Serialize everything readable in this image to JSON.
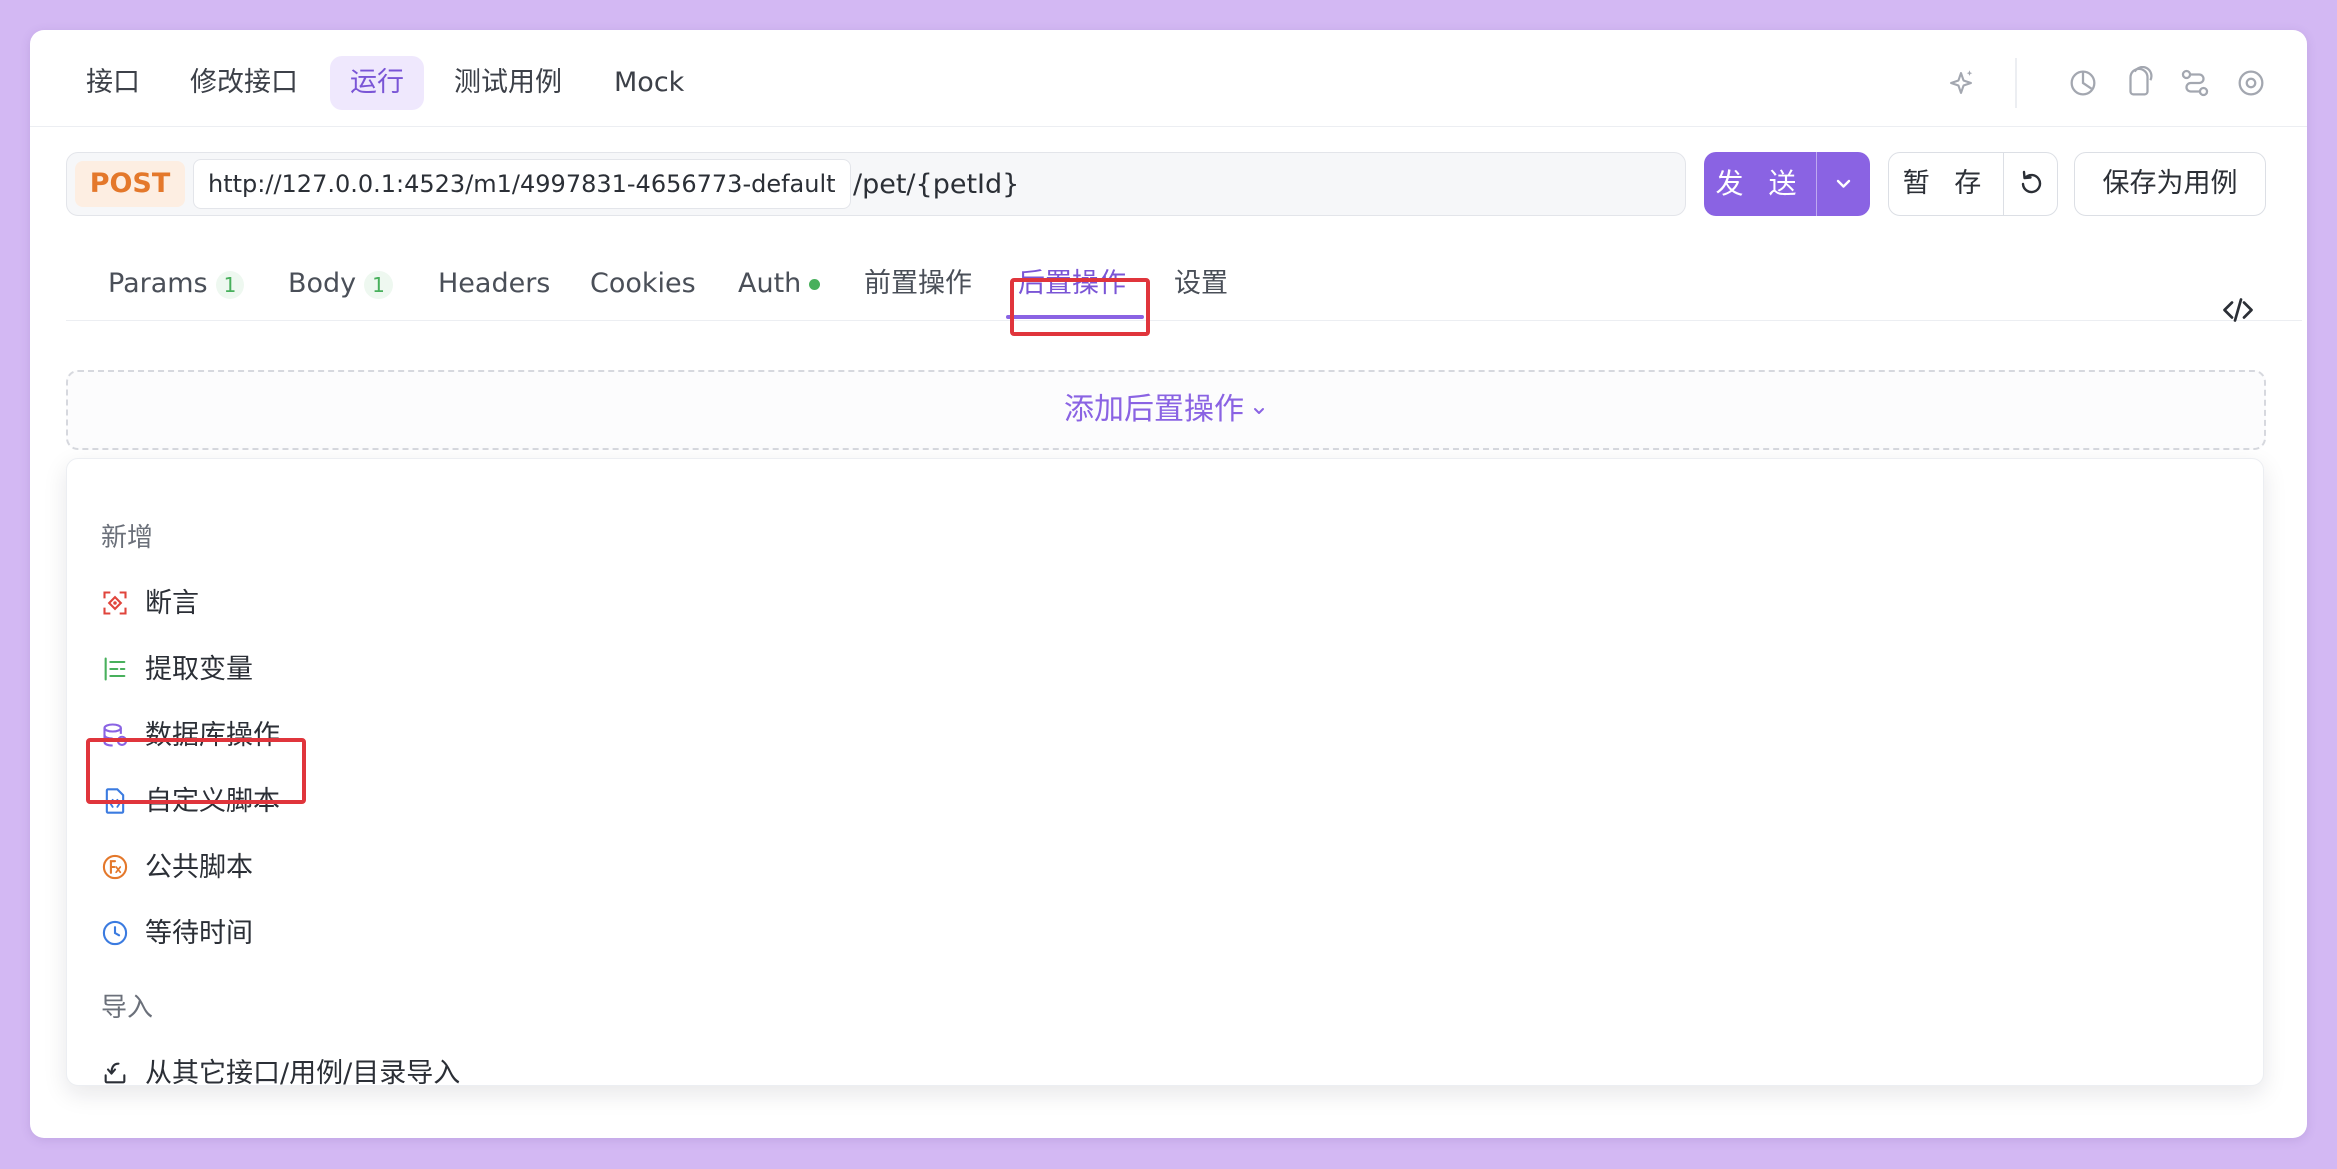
{
  "top_nav": {
    "tabs": [
      {
        "label": "接口"
      },
      {
        "label": "修改接口"
      },
      {
        "label": "运行",
        "active": true
      },
      {
        "label": "测试用例"
      },
      {
        "label": "Mock"
      }
    ],
    "icons": [
      "ai-sparkle-icon",
      "chart-icon",
      "bookmark-icon",
      "flow-icon",
      "settings-icon"
    ]
  },
  "request": {
    "method": "POST",
    "base_url": "http://127.0.0.1:4523/m1/4997831-4656773-default",
    "path": "/pet/{petId}",
    "send_label": "发 送",
    "stage_label": "暂 存",
    "save_case_label": "保存为用例"
  },
  "sub_tabs": {
    "items": [
      {
        "label": "Params",
        "badge": "1"
      },
      {
        "label": "Body",
        "badge": "1"
      },
      {
        "label": "Headers"
      },
      {
        "label": "Cookies"
      },
      {
        "label": "Auth",
        "dot": true
      },
      {
        "label": "前置操作"
      },
      {
        "label": "后置操作",
        "active": true
      },
      {
        "label": "设置"
      }
    ]
  },
  "post_ops": {
    "add_label": "添加后置操作"
  },
  "dropdown": {
    "group_new": "新增",
    "items_new": [
      {
        "label": "断言",
        "icon": "assert-icon",
        "color": "#e0453c"
      },
      {
        "label": "提取变量",
        "icon": "extract-variable-icon",
        "color": "#48b05c"
      },
      {
        "label": "数据库操作",
        "icon": "database-icon",
        "color": "#8a63e3"
      },
      {
        "label": "自定义脚本",
        "icon": "script-file-icon",
        "color": "#3b7be0"
      },
      {
        "label": "公共脚本",
        "icon": "function-icon",
        "color": "#e4782b"
      },
      {
        "label": "等待时间",
        "icon": "clock-icon",
        "color": "#3b7be0"
      }
    ],
    "group_import": "导入",
    "items_import": [
      {
        "label": "从其它接口/用例/目录导入",
        "icon": "import-icon"
      }
    ]
  },
  "colors": {
    "accent": "#8a63e3",
    "background": "#d3b8f3",
    "highlight": "#e0353c",
    "method": "#e4782b"
  }
}
